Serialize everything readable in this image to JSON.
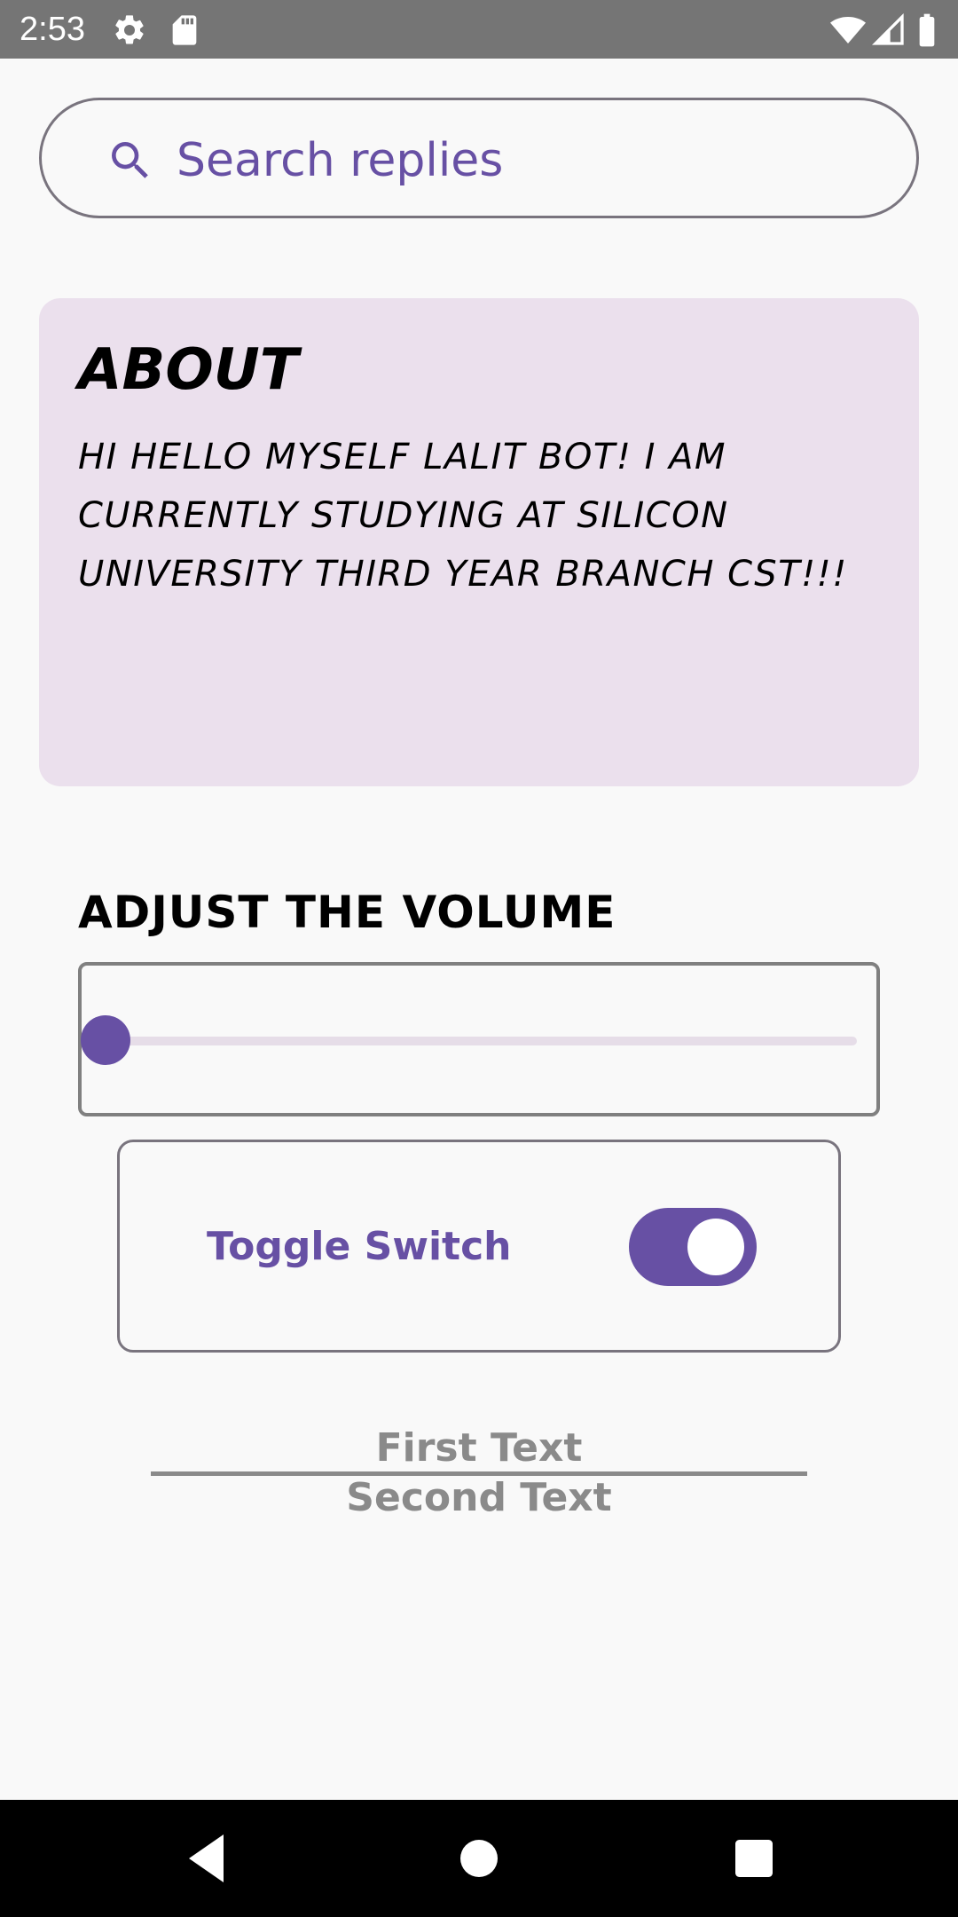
{
  "status_bar": {
    "time": "2:53",
    "icons": [
      "settings-icon",
      "sd-card-icon",
      "wifi-icon",
      "signal-icon",
      "battery-icon"
    ]
  },
  "search": {
    "placeholder": "Search replies",
    "icon": "search-icon"
  },
  "about": {
    "title": "ABOUT",
    "body": "HI HELLO MYSELF LALIT BOT! I AM CURRENTLY STUDYING AT SILICON UNIVERSITY THIRD YEAR BRANCH CST!!!"
  },
  "volume": {
    "label": "ADJUST THE VOLUME",
    "value": 0
  },
  "toggle": {
    "label": "Toggle Switch",
    "checked": true
  },
  "texts": {
    "first": "First Text",
    "second": "Second Text"
  },
  "nav": {
    "buttons": [
      "back-icon",
      "home-icon",
      "recents-icon"
    ]
  },
  "colors": {
    "accent": "#6750a4",
    "card_background": "#ebe0ed",
    "status_bar": "#757575",
    "nav_bar": "#000000",
    "muted_text": "#8a8a8a"
  }
}
